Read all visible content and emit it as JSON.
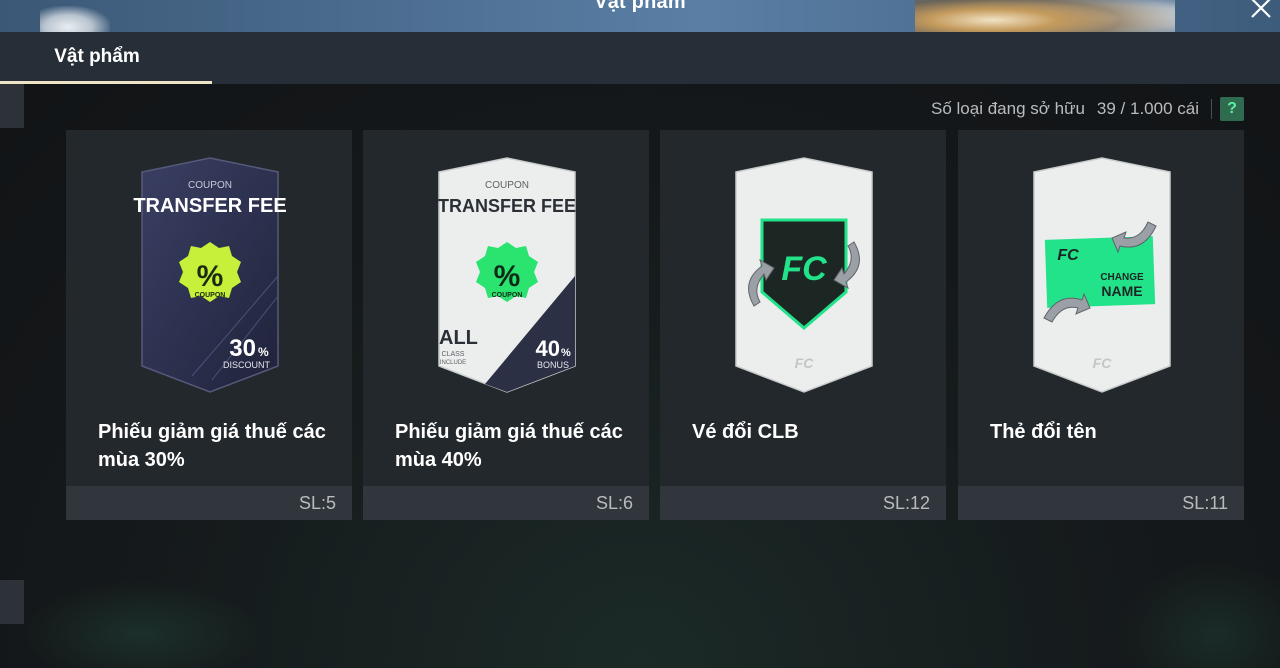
{
  "window": {
    "title": "Vật phẩm",
    "close_icon": "close-icon"
  },
  "tabs": [
    {
      "label": "Vật phẩm",
      "active": true
    }
  ],
  "inventory": {
    "owned_label": "Số loại đang sở hữu",
    "owned_value": "39 / 1.000 cái",
    "help_label": "?"
  },
  "items": [
    {
      "name": "Phiếu giảm giá thuế các mùa 30%",
      "qty": "SL:5",
      "art": {
        "top_label": "COUPON",
        "title": "TRANSFER FEE",
        "badge_symbol": "%",
        "badge_label": "COUPON",
        "value": "30",
        "value_unit": "%",
        "value_label": "DISCOUNT"
      }
    },
    {
      "name": "Phiếu giảm giá thuế các mùa 40%",
      "qty": "SL:6",
      "art": {
        "top_label": "COUPON",
        "title": "TRANSFER FEE",
        "badge_symbol": "%",
        "badge_label": "COUPON",
        "value": "40",
        "value_unit": "%",
        "value_label": "BONUS",
        "class_big": "ALL",
        "class_small_1": "CLASS",
        "class_small_2": "INCLUDE"
      }
    },
    {
      "name": "Vé đổi CLB",
      "qty": "SL:12",
      "art": {
        "icon": "club-change-icon"
      }
    },
    {
      "name": "Thẻ đổi tên",
      "qty": "SL:11",
      "art": {
        "icon": "name-change-icon",
        "line1": "CHANGE",
        "line2": "NAME"
      }
    }
  ],
  "colors": {
    "accent_green": "#22e28a",
    "badge_lime": "#c6f03a",
    "tab_underline": "#efe4c6"
  }
}
